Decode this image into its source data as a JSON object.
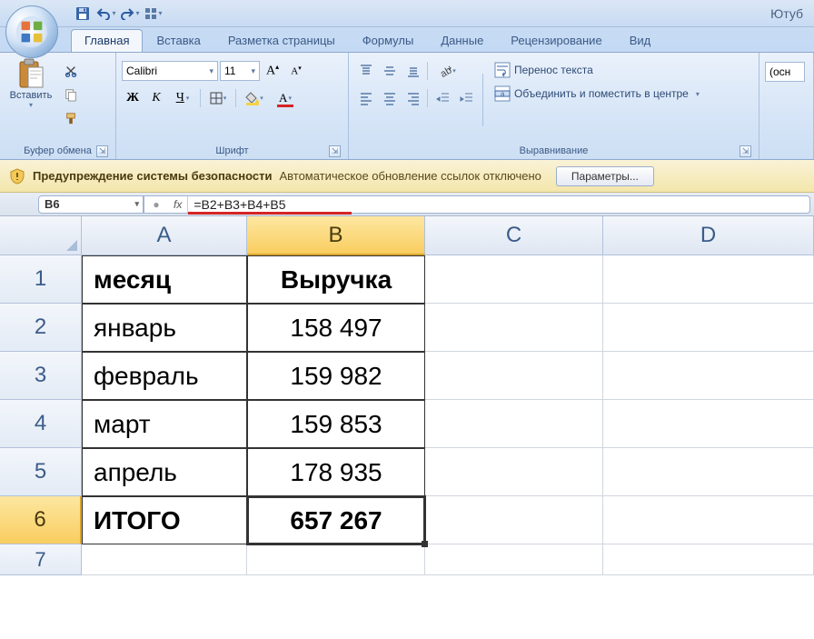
{
  "title": "Ютуб",
  "tabs": [
    "Главная",
    "Вставка",
    "Разметка страницы",
    "Формулы",
    "Данные",
    "Рецензирование",
    "Вид"
  ],
  "active_tab": 0,
  "clipboard": {
    "paste": "Вставить",
    "group": "Буфер обмена"
  },
  "font": {
    "group": "Шрифт",
    "name": "Calibri",
    "size": "11"
  },
  "alignment": {
    "group": "Выравнивание",
    "wrap": "Перенос текста",
    "merge": "Объединить и поместить в центре"
  },
  "security": {
    "bold": "Предупреждение системы безопасности",
    "msg": "Автоматическое обновление ссылок отключено",
    "btn": "Параметры..."
  },
  "namebox": "B6",
  "formula": "=B2+B3+B4+B5",
  "columns": [
    "A",
    "B",
    "C",
    "D"
  ],
  "rows": [
    "1",
    "2",
    "3",
    "4",
    "5",
    "6",
    "7"
  ],
  "table": {
    "header": {
      "a": "месяц",
      "b": "Выручка"
    },
    "r2": {
      "a": "январь",
      "b": "158 497"
    },
    "r3": {
      "a": "февраль",
      "b": "159 982"
    },
    "r4": {
      "a": "март",
      "b": "159 853"
    },
    "r5": {
      "a": "апрель",
      "b": "178 935"
    },
    "r6": {
      "a": "ИТОГО",
      "b": "657 267"
    }
  },
  "fx_label": "fx"
}
